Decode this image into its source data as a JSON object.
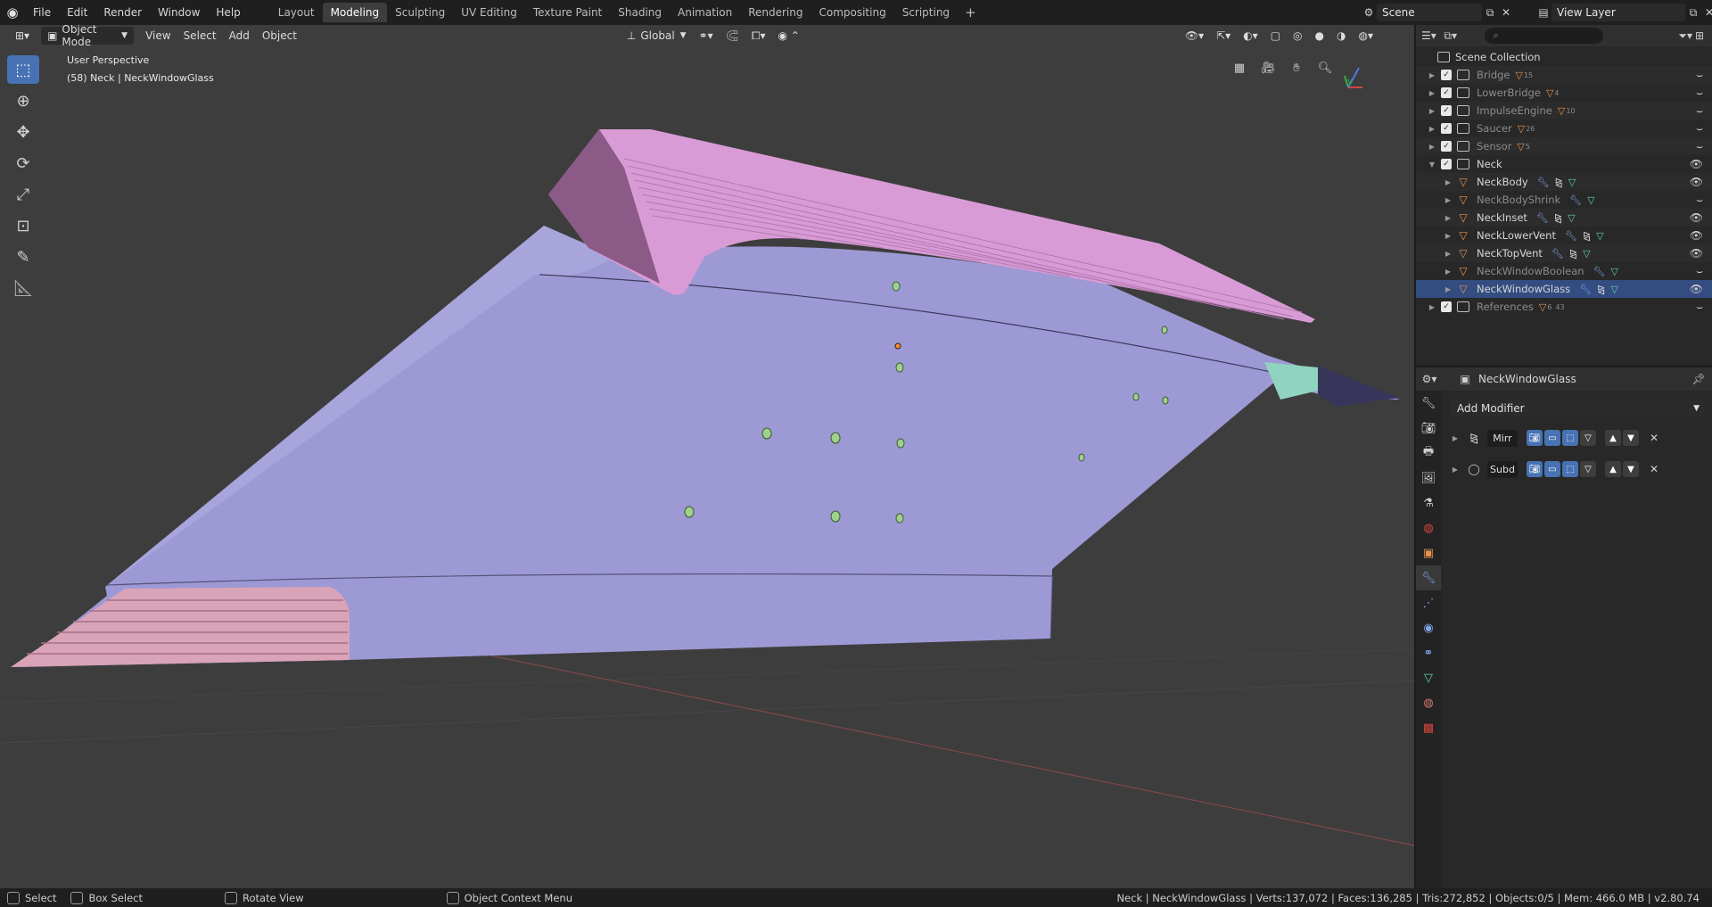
{
  "menus": [
    "File",
    "Edit",
    "Render",
    "Window",
    "Help"
  ],
  "workspaces": [
    "Layout",
    "Modeling",
    "Sculpting",
    "UV Editing",
    "Texture Paint",
    "Shading",
    "Animation",
    "Rendering",
    "Compositing",
    "Scripting"
  ],
  "active_workspace": "Modeling",
  "scene": "Scene",
  "view_layer": "View Layer",
  "viewport": {
    "mode": "Object Mode",
    "menus": [
      "View",
      "Select",
      "Add",
      "Object"
    ],
    "transform_orientation": "Global",
    "view_name": "User Perspective",
    "context_line": "(58) Neck | NeckWindowGlass"
  },
  "outliner": {
    "root": "Scene Collection",
    "rows": [
      {
        "name": "Bridge",
        "count": "15",
        "level": 0,
        "dim": true
      },
      {
        "name": "LowerBridge",
        "count": "4",
        "level": 0,
        "dim": true
      },
      {
        "name": "ImpulseEngine",
        "count": "10",
        "level": 0,
        "dim": true
      },
      {
        "name": "Saucer",
        "count": "26",
        "level": 0,
        "dim": true
      },
      {
        "name": "Sensor",
        "count": "5",
        "level": 0,
        "dim": true
      },
      {
        "name": "Neck",
        "count": "",
        "level": 0,
        "dim": false
      },
      {
        "name": "NeckBody",
        "count": "",
        "level": 1,
        "dim": false
      },
      {
        "name": "NeckBodyShrink",
        "count": "",
        "level": 1,
        "dim": true
      },
      {
        "name": "NeckInset",
        "count": "",
        "level": 1,
        "dim": false
      },
      {
        "name": "NeckLowerVent",
        "count": "",
        "level": 1,
        "dim": false
      },
      {
        "name": "NeckTopVent",
        "count": "",
        "level": 1,
        "dim": false
      },
      {
        "name": "NeckWindowBoolean",
        "count": "",
        "level": 1,
        "dim": true
      },
      {
        "name": "NeckWindowGlass",
        "count": "",
        "level": 1,
        "dim": false
      },
      {
        "name": "References",
        "count": "6",
        "count2": "43",
        "level": 0,
        "dim": true
      }
    ]
  },
  "properties": {
    "object_name": "NeckWindowGlass",
    "add_modifier": "Add Modifier",
    "modifiers": [
      {
        "name": "Mirr"
      },
      {
        "name": "Subd"
      }
    ]
  },
  "statusbar": {
    "select": "Select",
    "box_select": "Box Select",
    "rotate_view": "Rotate View",
    "context_menu": "Object Context Menu",
    "stats": "Neck | NeckWindowGlass | Verts:137,072 | Faces:136,285 | Tris:272,852 | Objects:0/5 | Mem: 466.0 MB | v2.80.74"
  },
  "colors": {
    "hull": "#9d99d4",
    "vent": "#d99bd6",
    "lower_vent": "#d9a3b8",
    "accent": "#4772b3"
  }
}
